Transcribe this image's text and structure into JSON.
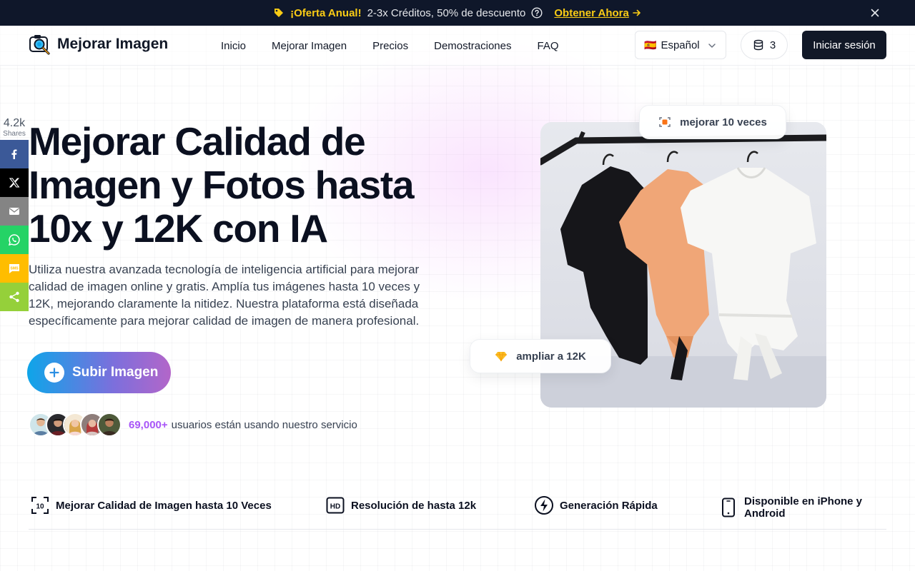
{
  "promo": {
    "offer": "¡Oferta Anual!",
    "description": "2-3x Créditos, 50% de descuento",
    "cta": "Obtener Ahora",
    "bg_color": "#0f172a",
    "accent_color": "#facc15"
  },
  "nav": {
    "logo_text": "Mejorar Imagen",
    "links": [
      "Inicio",
      "Mejorar Imagen",
      "Precios",
      "Demostraciones",
      "FAQ"
    ],
    "language": {
      "flag": "🇪🇸",
      "label": "Español"
    },
    "credits": "3",
    "login": "Iniciar sesión"
  },
  "share": {
    "count": "4.2k",
    "count_label": "Shares",
    "buttons": [
      {
        "name": "facebook",
        "icon": "facebook-icon",
        "color": "#3b5998"
      },
      {
        "name": "x",
        "icon": "x-icon",
        "color": "#000000"
      },
      {
        "name": "email",
        "icon": "email-icon",
        "color": "#848484"
      },
      {
        "name": "whatsapp",
        "icon": "whatsapp-icon",
        "color": "#25d366"
      },
      {
        "name": "sms",
        "icon": "sms-icon",
        "color": "#ffbd00"
      },
      {
        "name": "share",
        "icon": "share-icon",
        "color": "#95d03a"
      }
    ]
  },
  "hero": {
    "title": "Mejorar Calidad de Imagen y Fotos hasta 10x y 12K con IA",
    "description": "Utiliza nuestra avanzada tecnología de inteligencia artificial para mejorar calidad de imagen online y gratis. Amplía tus imágenes hasta 10 veces y 12K, mejorando claramente la nitidez. Nuestra plataforma está diseñada específicamente para mejorar calidad de imagen de manera profesional.",
    "upload_button": "Subir Imagen",
    "users_count": "69,000+",
    "users_text": "usuarios están usando nuestro servicio"
  },
  "badges": {
    "top": "mejorar 10 veces",
    "bottom": "ampliar a 12K"
  },
  "features": [
    {
      "icon": "scan-10x-icon",
      "label": "Mejorar Calidad de Imagen hasta 10 Veces"
    },
    {
      "icon": "hd-icon",
      "label": "Resolución de hasta 12k"
    },
    {
      "icon": "lightning-icon",
      "label": "Generación Rápida"
    },
    {
      "icon": "smartphone-icon",
      "label": "Disponible en iPhone y Android"
    }
  ]
}
